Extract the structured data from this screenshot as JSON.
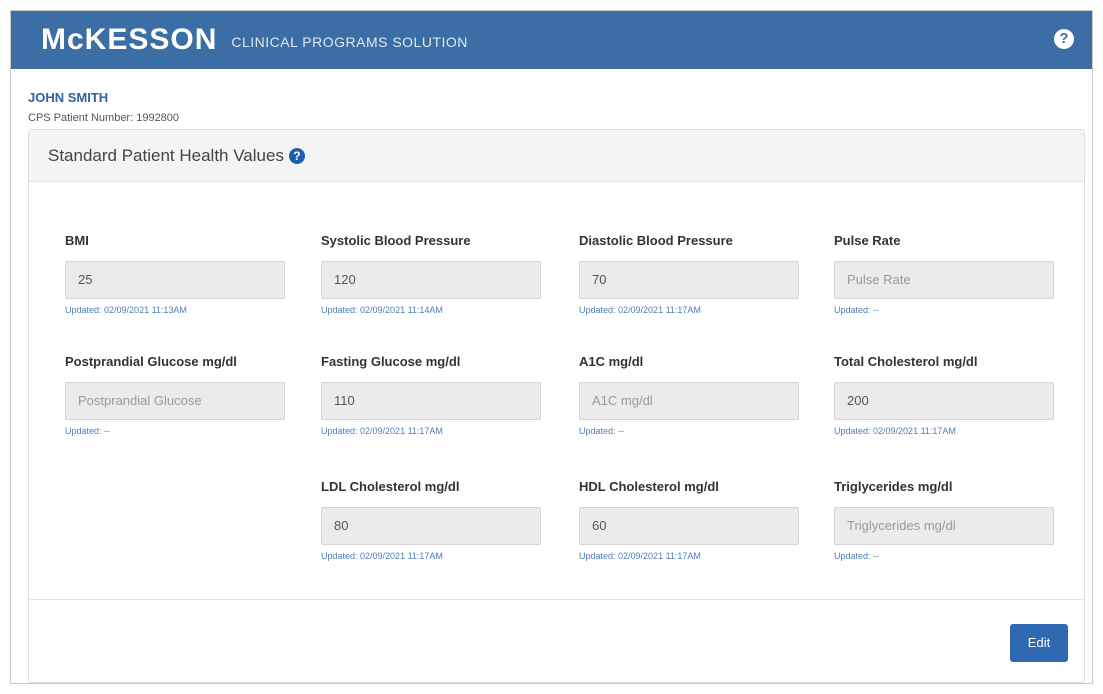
{
  "header": {
    "brand": "McKESSON",
    "subtitle": "CLINICAL PROGRAMS SOLUTION",
    "help_icon": "?"
  },
  "patient": {
    "name": "JOHN SMITH",
    "number_line": "CPS Patient Number: 1992800"
  },
  "panel": {
    "title": "Standard Patient Health Values",
    "help_icon": "?"
  },
  "fields": [
    {
      "label": "BMI",
      "value": "25",
      "placeholder": "",
      "updated": "Updated: 02/09/2021 11:13AM"
    },
    {
      "label": "Systolic Blood Pressure",
      "value": "120",
      "placeholder": "",
      "updated": "Updated: 02/09/2021 11:14AM"
    },
    {
      "label": "Diastolic Blood Pressure",
      "value": "70",
      "placeholder": "",
      "updated": "Updated: 02/09/2021 11:17AM"
    },
    {
      "label": "Pulse Rate",
      "value": "",
      "placeholder": "Pulse Rate",
      "updated": "Updated: --"
    },
    {
      "label": "Postprandial Glucose mg/dl",
      "value": "",
      "placeholder": "Postprandial Glucose",
      "updated": "Updated: --"
    },
    {
      "label": "Fasting Glucose mg/dl",
      "value": "110",
      "placeholder": "",
      "updated": "Updated: 02/09/2021 11:17AM"
    },
    {
      "label": "A1C mg/dl",
      "value": "",
      "placeholder": "A1C mg/dl",
      "updated": "Updated: --"
    },
    {
      "label": "Total Cholesterol mg/dl",
      "value": "200",
      "placeholder": "",
      "updated": "Updated: 02/09/2021 11:17AM"
    },
    {
      "label": "LDL Cholesterol mg/dl",
      "value": "80",
      "placeholder": "",
      "updated": "Updated: 02/09/2021 11:17AM"
    },
    {
      "label": "HDL Cholesterol mg/dl",
      "value": "60",
      "placeholder": "",
      "updated": "Updated: 02/09/2021 11:17AM"
    },
    {
      "label": "Triglycerides mg/dl",
      "value": "",
      "placeholder": "Triglycerides mg/dl",
      "updated": "Updated: --"
    }
  ],
  "actions": {
    "edit_label": "Edit"
  },
  "colors": {
    "header_bg": "#3a6ea5",
    "accent": "#2f69b1",
    "link": "#4f7db8"
  }
}
